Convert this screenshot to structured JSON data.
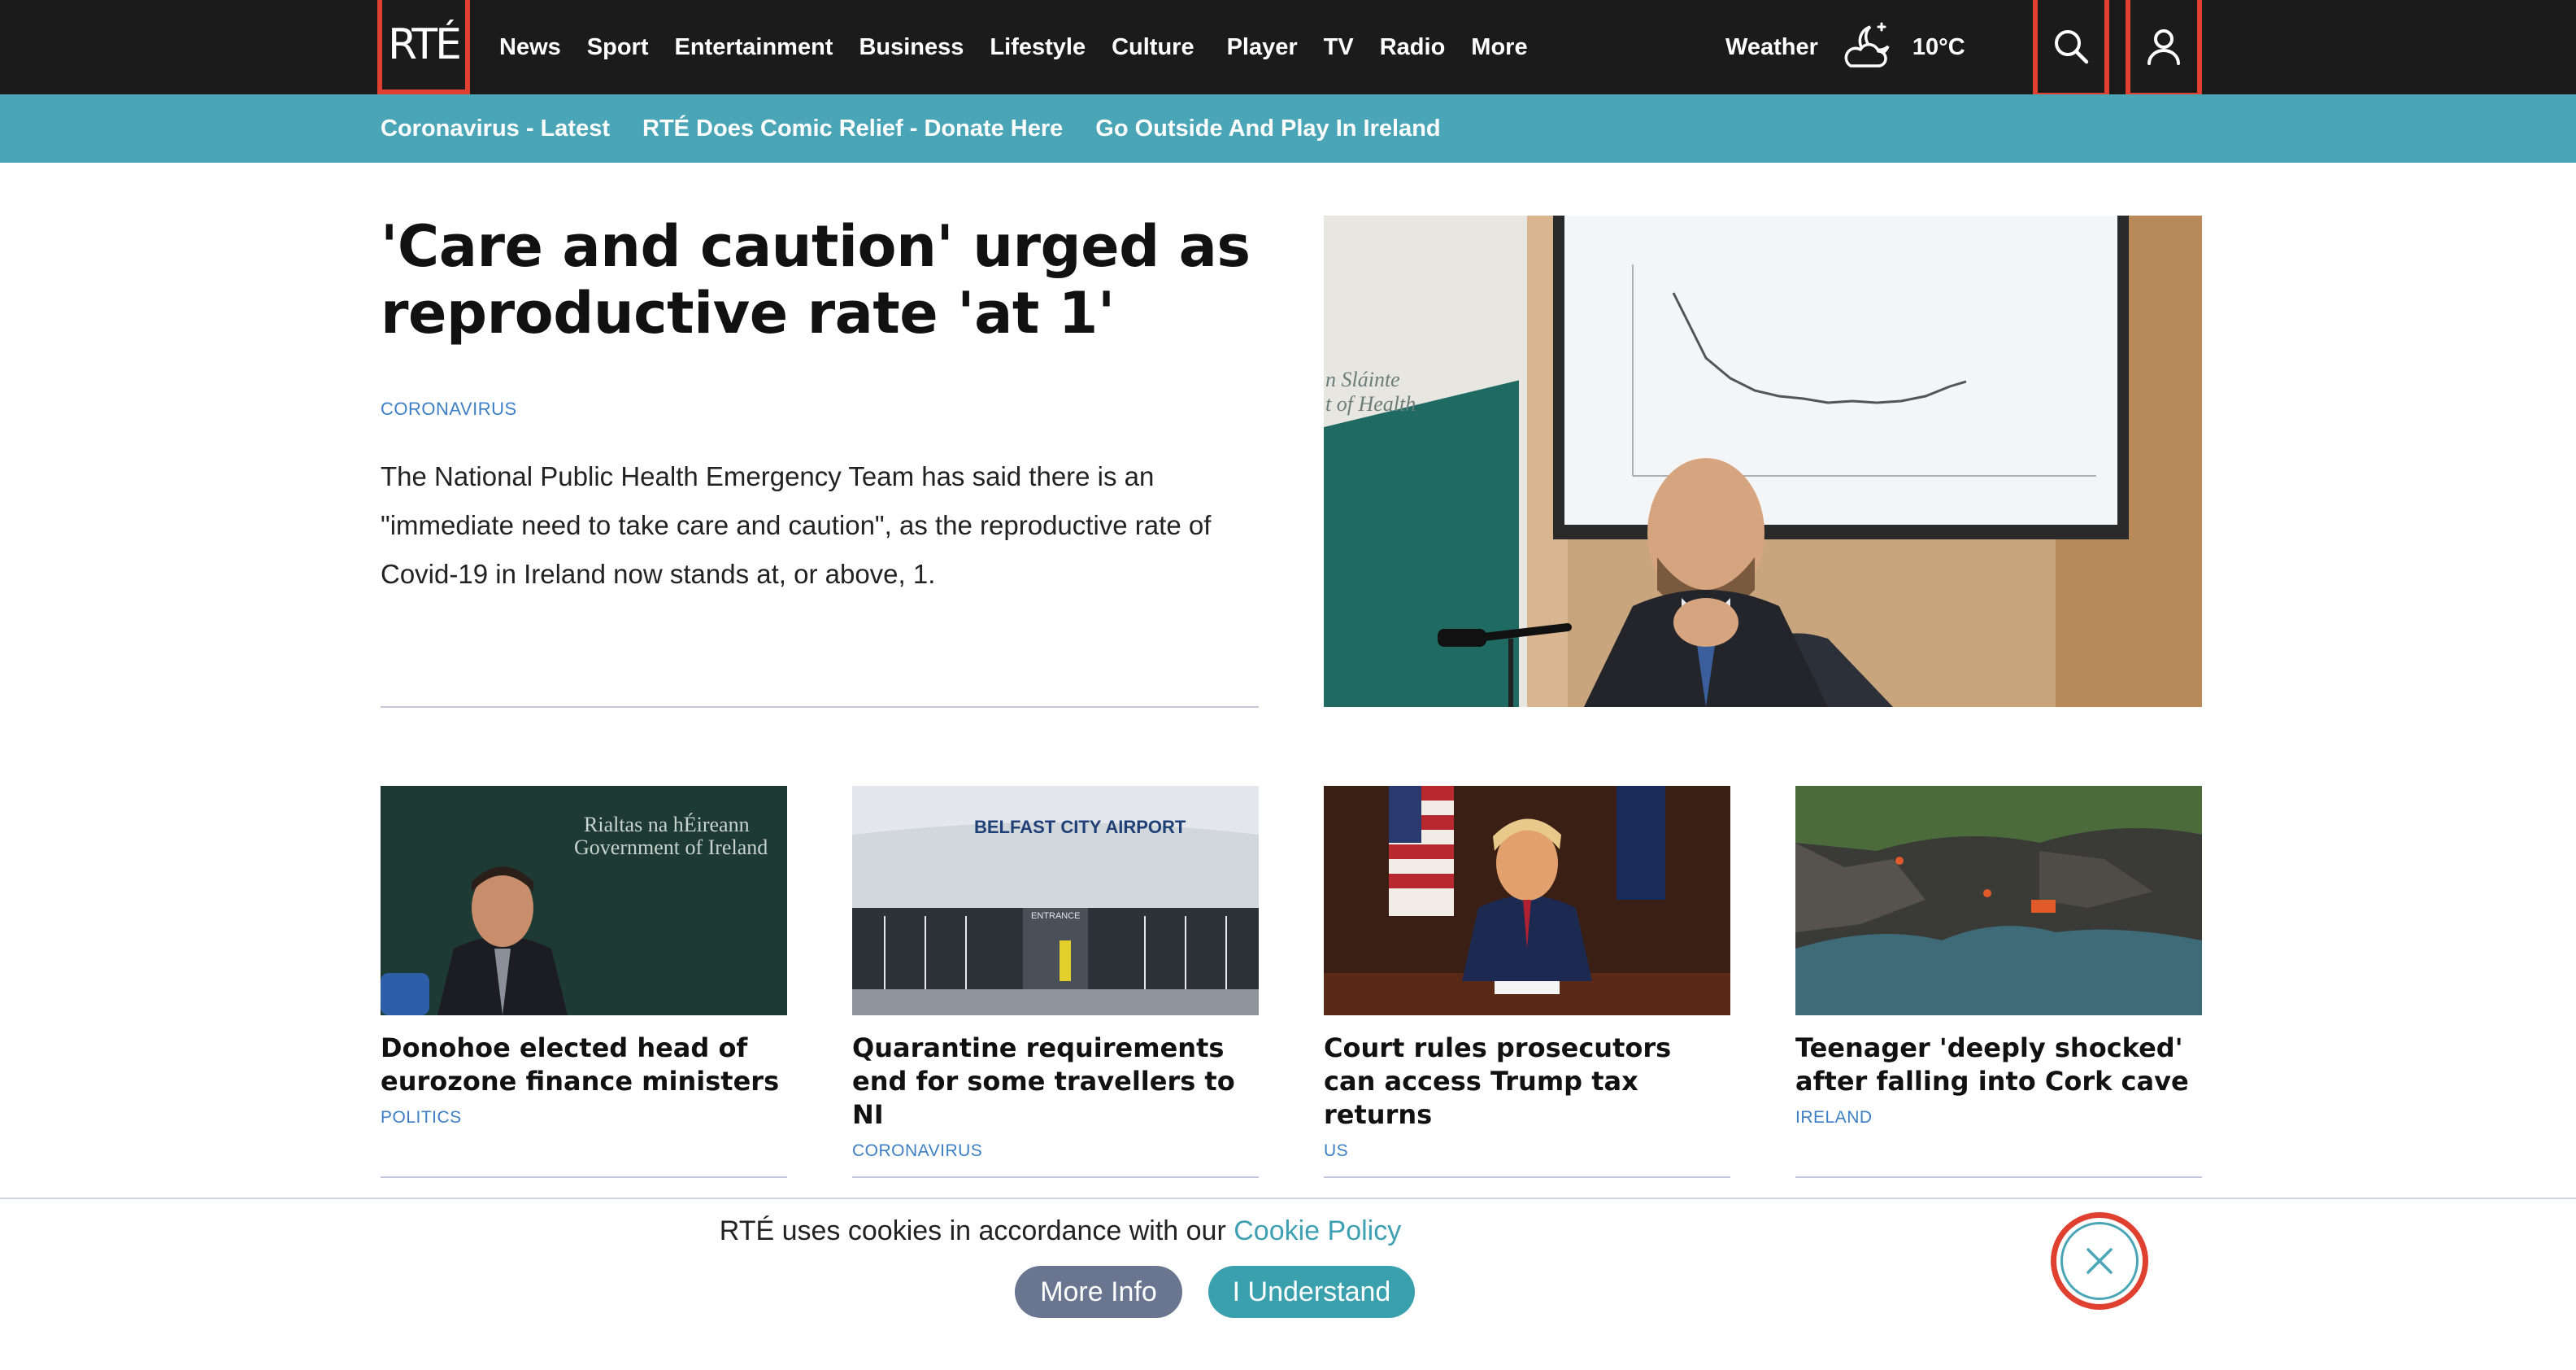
{
  "header": {
    "logo": "RTÉ",
    "nav": [
      "News",
      "Sport",
      "Entertainment",
      "Business",
      "Lifestyle",
      "Culture",
      "Player",
      "TV",
      "Radio",
      "More"
    ],
    "weather_label": "Weather",
    "weather_temp": "10°C",
    "weather_icon": "partly-cloudy-night-icon",
    "search_icon": "search-icon",
    "user_icon": "user-icon",
    "accent_color": "#e0402f"
  },
  "subnav": {
    "items": [
      "Coronavirus - Latest",
      "RTÉ Does Comic Relief - Donate Here",
      "Go Outside And Play In Ireland"
    ],
    "background": "#4aa5b6"
  },
  "lead": {
    "title": "'Care and caution' urged as reproductive rate 'at 1'",
    "tag": "CORONAVIRUS",
    "summary": "The National Public Health Emergency Team has said there is an \"immediate need to take care and caution\", as the reproductive rate of Covid-19 in Ireland now stands at, or above, 1.",
    "image_wall_text": "n Sláinte\nt of Health"
  },
  "stories": [
    {
      "title": "Donohoe elected head of eurozone finance ministers",
      "tag": "POLITICS",
      "image_text": "Rialtas na hÉireann\nGovernment of Ireland"
    },
    {
      "title": "Quarantine requirements end for some travellers to NI",
      "tag": "CORONAVIRUS",
      "image_text": "BELFAST CITY AIRPORT",
      "image_subtext": "ENTRANCE"
    },
    {
      "title": "Court rules prosecutors can access Trump tax returns",
      "tag": "US"
    },
    {
      "title": "Teenager 'deeply shocked' after falling into Cork cave",
      "tag": "IRELAND"
    }
  ],
  "cookie": {
    "text": "RTÉ uses cookies in accordance with our ",
    "link": "Cookie Policy",
    "more_info": "More Info",
    "understand": "I Understand",
    "close_icon": "close-icon"
  }
}
